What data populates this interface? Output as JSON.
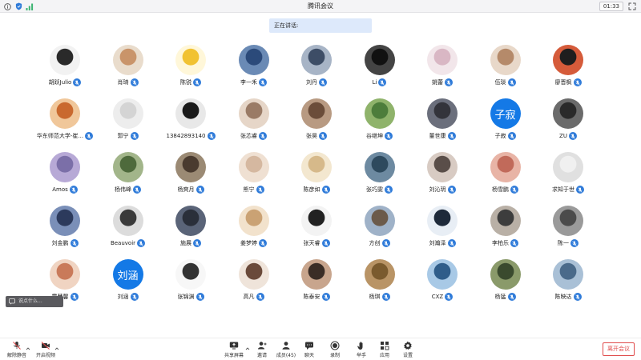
{
  "window": {
    "title": "腾讯会议",
    "timer": "01:33"
  },
  "speaking": {
    "label": "正在讲话:"
  },
  "participants": [
    {
      "name": "胡跃Julio",
      "avatar": "#2a2a2a",
      "bg": "#f2f2f2"
    },
    {
      "name": "肖琦",
      "avatar": "#c9946a",
      "bg": "#e9dccc"
    },
    {
      "name": "陈锐",
      "avatar": "#f1c232",
      "bg": "#fff7d9"
    },
    {
      "name": "李一禾",
      "avatar": "#2b4a7a",
      "bg": "#6a8ab5"
    },
    {
      "name": "刘丹",
      "avatar": "#3d4d66",
      "bg": "#a7b4c6"
    },
    {
      "name": "Li",
      "avatar": "#111111",
      "bg": "#444444"
    },
    {
      "name": "姚蕾",
      "avatar": "#d9b7c4",
      "bg": "#f2e6ea"
    },
    {
      "name": "伍琰",
      "avatar": "#b58a6a",
      "bg": "#e8d8c9"
    },
    {
      "name": "廖晋枫",
      "avatar": "#1e1e1e",
      "bg": "#d55b3a"
    },
    {
      "name": "华东师范大学-崔...",
      "avatar": "#c9692e",
      "bg": "#f0c79a"
    },
    {
      "name": "郭宁",
      "avatar": "#d4d4d4",
      "bg": "#ededed"
    },
    {
      "name": "13842893140",
      "avatar": "#1a1a1a",
      "bg": "#e8e8e8"
    },
    {
      "name": "张芯睿",
      "avatar": "#9a7b66",
      "bg": "#e6d6c8"
    },
    {
      "name": "张昊",
      "avatar": "#6b4d3a",
      "bg": "#b89a82"
    },
    {
      "name": "谷继坤",
      "avatar": "#4d7d3b",
      "bg": "#8fb36b"
    },
    {
      "name": "董世康",
      "avatar": "#33343b",
      "bg": "#6b6f7c"
    },
    {
      "name": "子寂",
      "avatar": "#1479e6",
      "bg": "#1479e6",
      "text": "子寂"
    },
    {
      "name": "ZU",
      "avatar": "#2a2a2a",
      "bg": "#6b6b6b"
    },
    {
      "name": "Amos",
      "avatar": "#7b6fa8",
      "bg": "#b7a9d6"
    },
    {
      "name": "杨伟峰",
      "avatar": "#4e6a3c",
      "bg": "#a2b58a"
    },
    {
      "name": "杨爽月",
      "avatar": "#4a3b2f",
      "bg": "#9b8a74"
    },
    {
      "name": "熊宁",
      "avatar": "#d5b8a0",
      "bg": "#efe0d2"
    },
    {
      "name": "陈彦如",
      "avatar": "#d6b98a",
      "bg": "#f3e7cf"
    },
    {
      "name": "张巧雯",
      "avatar": "#2e4a5e",
      "bg": "#6d8aa1"
    },
    {
      "name": "刘沁玥",
      "avatar": "#5a4e49",
      "bg": "#d8cbc3"
    },
    {
      "name": "杨雪鹏",
      "avatar": "#c16a5a",
      "bg": "#e8b4a6"
    },
    {
      "name": "求知于世",
      "avatar": "#f0f0f0",
      "bg": "#e0e0e0"
    },
    {
      "name": "刘金鹏",
      "avatar": "#2c3a5c",
      "bg": "#7a8fb8"
    },
    {
      "name": "Beauvoir",
      "avatar": "#3a3a3a",
      "bg": "#dcdcdc"
    },
    {
      "name": "施展",
      "avatar": "#2a2f3a",
      "bg": "#5a6478"
    },
    {
      "name": "姜梦婷",
      "avatar": "#caa274",
      "bg": "#f2e2cc"
    },
    {
      "name": "张天睿",
      "avatar": "#222222",
      "bg": "#f3f3f3"
    },
    {
      "name": "方创",
      "avatar": "#6b5a4a",
      "bg": "#9fb2c8"
    },
    {
      "name": "刘瀚泽",
      "avatar": "#1e2a3a",
      "bg": "#e8eef5"
    },
    {
      "name": "李柏乐",
      "avatar": "#3d3d3d",
      "bg": "#b9b0a6"
    },
    {
      "name": "陈一",
      "avatar": "#4b4b4b",
      "bg": "#9a9a9a"
    },
    {
      "name": "霍慧馨",
      "avatar": "#c97a5a",
      "bg": "#f0d4c2"
    },
    {
      "name": "刘涵",
      "avatar": "#1479e6",
      "bg": "#1479e6",
      "text": "刘涵"
    },
    {
      "name": "张锦渊",
      "avatar": "#333333",
      "bg": "#f7f7f7"
    },
    {
      "name": "高凡",
      "avatar": "#6a4a3a",
      "bg": "#efe4da"
    },
    {
      "name": "陈泰安",
      "avatar": "#3a2d26",
      "bg": "#c8a58d"
    },
    {
      "name": "杨琪",
      "avatar": "#7a5a2e",
      "bg": "#b99466"
    },
    {
      "name": "CXZ",
      "avatar": "#2f5d8a",
      "bg": "#a8c9e6"
    },
    {
      "name": "杨猛",
      "avatar": "#3a4a2e",
      "bg": "#8a9a6a"
    },
    {
      "name": "陈映达",
      "avatar": "#4a6a8a",
      "bg": "#a9c0d6"
    }
  ],
  "chat_preview": {
    "text": "说点什么..."
  },
  "toolbar": {
    "mute": "解除静音",
    "video": "开启视频",
    "share": "共享屏幕",
    "invite": "邀请",
    "members": "成员(45)",
    "chat": "聊天",
    "record": "录制",
    "raise_hand": "举手",
    "apps": "应用",
    "settings": "设置",
    "leave": "离开会议"
  },
  "colors": {
    "accent": "#2f7bd9",
    "danger": "#e04b4b",
    "banner": "#dde9fb"
  }
}
